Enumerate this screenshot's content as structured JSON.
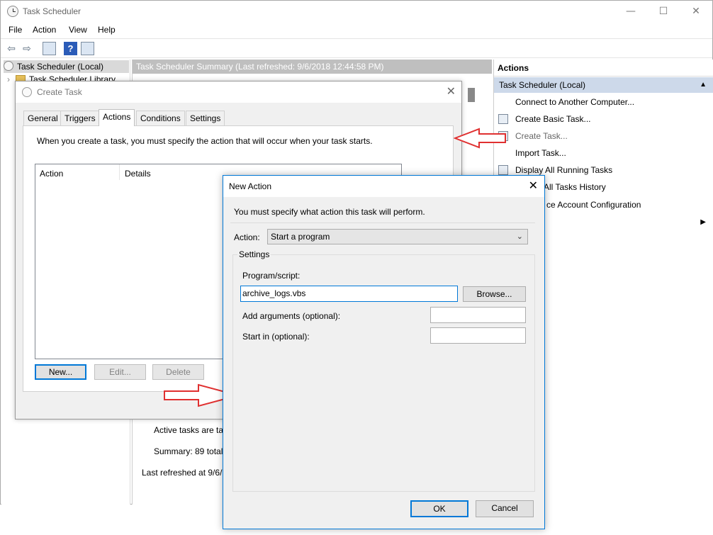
{
  "window": {
    "title": "Task Scheduler",
    "minimize": "—",
    "maximize": "☐",
    "close": "✕"
  },
  "menu": [
    "File",
    "Action",
    "View",
    "Help"
  ],
  "toolbar": {
    "back": "⇦",
    "forward": "⇨",
    "help": "?"
  },
  "tree": {
    "root": "Task Scheduler (Local)",
    "child": "Task Scheduler Library",
    "expander": "›"
  },
  "center": {
    "header": "Task Scheduler Summary (Last refreshed: 9/6/2018 12:44:58 PM)",
    "active_tasks": "Active tasks are tas",
    "summary": "Summary: 89 total",
    "last_refreshed": "Last refreshed at 9/6/2"
  },
  "actions_pane": {
    "title": "Actions",
    "section": "Task Scheduler (Local)",
    "collapse": "▲",
    "items": [
      {
        "label": "Connect to Another Computer...",
        "disabled": false
      },
      {
        "label": "Create Basic Task...",
        "disabled": false
      },
      {
        "label": "Create Task...",
        "disabled": true
      },
      {
        "label": "Import Task...",
        "disabled": false
      },
      {
        "label": "Display All Running Tasks",
        "disabled": false
      },
      {
        "label": "All Tasks History",
        "disabled": false
      },
      {
        "label": "ce Account Configuration",
        "disabled": false
      }
    ],
    "submenu_arrow": "▶"
  },
  "create_task": {
    "title": "Create Task",
    "close": "✕",
    "tabs": [
      "General",
      "Triggers",
      "Actions",
      "Conditions",
      "Settings"
    ],
    "active_tab": "Actions",
    "description": "When you create a task, you must specify the action that will occur when your task starts.",
    "columns": [
      "Action",
      "Details"
    ],
    "buttons": {
      "new": "New...",
      "edit": "Edit...",
      "delete": "Delete"
    }
  },
  "new_action": {
    "title": "New Action",
    "close": "✕",
    "instruction": "You must specify what action this task will perform.",
    "action_label": "Action:",
    "action_value": "Start a program",
    "settings_label": "Settings",
    "program_label": "Program/script:",
    "program_value": "archive_logs.vbs",
    "browse": "Browse...",
    "args_label": "Add arguments (optional):",
    "args_value": "",
    "start_in_label": "Start in (optional):",
    "start_in_value": "",
    "ok": "OK",
    "cancel": "Cancel"
  },
  "colors": {
    "accent": "#0078d7",
    "arrow": "#e03030",
    "section_bg": "#cdd9ea"
  }
}
